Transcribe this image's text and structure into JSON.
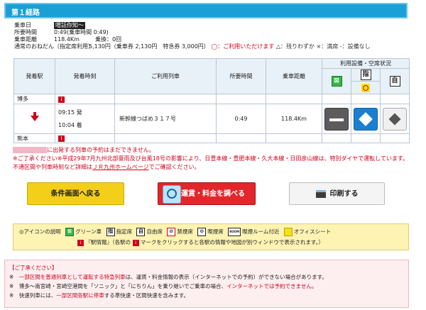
{
  "header": {
    "title": "第１経路"
  },
  "info": {
    "date_label": "乗車日",
    "date_value": "噌話你知〜",
    "time_label": "所要時間",
    "time_value": "0:49(乗車時間 0:49)",
    "distance_label": "乗車距離",
    "distance_value": "118.4Km",
    "transfer_label": "乗換：0回",
    "fare_label": "通常のおねだん（指定席利用）",
    "fare_value": "5,130円（乗車券 2,130円　特急券 3,000円）",
    "legend_text_1": "◯：ご利用いただけます",
    "legend_text_2": "△：残りわずか",
    "legend_text_3": "×：満席",
    "legend_text_4": "-：設備なし"
  },
  "table": {
    "headers": {
      "dep_station": "発着駅",
      "dep_time": "発着時刻",
      "train": "ご利用列車",
      "duration": "所要時間",
      "distance": "乗車距離",
      "facilities": "利用設備・空席状況"
    },
    "facility_icons": {
      "green": "⊠",
      "shitei": "指",
      "free": "自"
    },
    "rows": {
      "from_station": "博多",
      "dep_time": "09:15 発",
      "arr_time": "10:04 着",
      "train_name": "新幹線つばめ３１７号",
      "duration": "0:49",
      "distance": "118.4Km",
      "to_station": "熊本"
    }
  },
  "warnings": {
    "line1": "に出発する列車の予約はまだできません。",
    "line2": "※ご了承ください※平成29年7月九州北部豪雨及び台風18号の影響により、日豊本線・豊肥本線・久大本線・日田彦山線は、特別ダイヤで運転しています。不通区間や列車時刻など詳細は",
    "link": "ＪＲ九州ホームページ",
    "line2_end": "でご確認ください。"
  },
  "buttons": {
    "back": "条件画面へ戻る",
    "fare": "運賃・料金を調べる",
    "print": "印刷する"
  },
  "legend": {
    "title": "◎アイコンの説明",
    "green": "グリーン車",
    "reserved": "指定席",
    "free": "自由席",
    "nosmoke": "禁煙席",
    "smoke": "喫煙席",
    "room": "喫煙ルーム付近",
    "office": "オフィスシート",
    "ekijoho": "『駅情報』（各駅の",
    "ekijoho_2": "マークをクリックすると各駅の情報や地図が別ウィンドウで表示されます。）",
    "ico_reserved": "指",
    "ico_free": "自",
    "ico_room": "ROOM"
  },
  "notice": {
    "title": "【ご了承ください】",
    "l1_a": "※　",
    "l1_red": "一部区間を普通列車として運転する特急列車",
    "l1_b": "は、運賃・料金情報の表示（インターネットでの予約）ができない場合があります。",
    "l2_a": "※　博多〜南宮崎・宮崎空港間を「ソニック」と「にちりん」を乗り継いでご乗車の場合、",
    "l2_red": "インターネットでは予約できません",
    "l2_b": "。",
    "l3_a": "※　快速列車には、",
    "l3_red": "一部区間各駅に停車",
    "l3_b": "する準快速・区間快速を含みます。"
  }
}
